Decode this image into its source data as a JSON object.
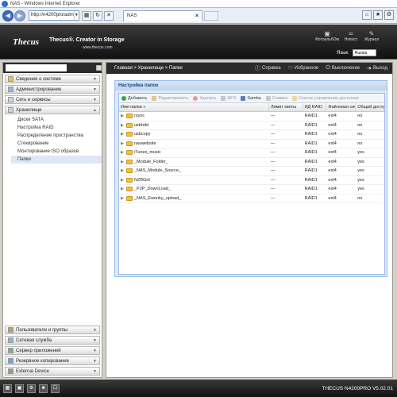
{
  "browser": {
    "title": "NAS - Windows Internet Explorer",
    "address": "http://n4200pro/adm",
    "tab_label": "NAS"
  },
  "header": {
    "brand": "Thecus",
    "tagline": "Thecus®. Creator in Storage",
    "website": "www.thecus.com",
    "icons": [
      {
        "label": "ФотоальбОм",
        "icon": "photo-album-icon"
      },
      {
        "label": "Новост",
        "icon": "rss-icon"
      },
      {
        "label": "Журнал",
        "icon": "log-icon"
      }
    ],
    "language_label": "Язык:",
    "language_value": "Russia"
  },
  "sidebar": {
    "sections_top": [
      {
        "label": "Сведения о системе",
        "icon": "info-icon"
      },
      {
        "label": "Администрирование",
        "icon": "admin-icon"
      },
      {
        "label": "Сеть и сервисы",
        "icon": "network-icon"
      },
      {
        "label": "Хранилище",
        "icon": "storage-icon"
      }
    ],
    "storage_items": [
      {
        "label": "Диски SATA"
      },
      {
        "label": "Настройка RAID"
      },
      {
        "label": "Распределение пространства"
      },
      {
        "label": "Стекирование"
      },
      {
        "label": "Монтирование ISO образов"
      },
      {
        "label": "Папки"
      }
    ],
    "sections_bottom": [
      {
        "label": "Пользователи и группы",
        "icon": "users-icon"
      },
      {
        "label": "Сетевая служба",
        "icon": "network-service-icon"
      },
      {
        "label": "Сервер приложений",
        "icon": "app-server-icon"
      },
      {
        "label": "Резервное копирование",
        "icon": "backup-icon"
      },
      {
        "label": "External Device",
        "icon": "external-device-icon"
      }
    ]
  },
  "breadcrumb": {
    "text": "Главная > Хранилище > Папки",
    "links": [
      {
        "label": "Справка",
        "icon": "help-icon"
      },
      {
        "label": "Избранное",
        "icon": "favorites-icon"
      },
      {
        "label": "Выключение",
        "icon": "power-icon"
      },
      {
        "label": "Выход",
        "icon": "logout-icon"
      }
    ]
  },
  "panel": {
    "title": "Настройка папок",
    "toolbar": [
      {
        "label": "Добавить",
        "icon": "add-icon",
        "enabled": true
      },
      {
        "label": "Редактировать",
        "icon": "edit-icon",
        "enabled": false
      },
      {
        "label": "Удалить",
        "icon": "delete-icon",
        "enabled": false
      },
      {
        "label": "NFS",
        "icon": "nfs-icon",
        "enabled": false
      },
      {
        "label": "Samba",
        "icon": "samba-icon",
        "enabled": true
      },
      {
        "label": "Снимок",
        "icon": "snapshot-icon",
        "enabled": false
      },
      {
        "label": "Список управления доступом",
        "icon": "acl-icon",
        "enabled": false
      }
    ],
    "columns": [
      "Имя папки »",
      "Лимит квоты",
      "ИД RAID",
      "Файловая система",
      "Общий доступ"
    ],
    "rows": [
      {
        "name": "rsync",
        "quota": "—",
        "raid": "RAID1",
        "fs": "ext4",
        "share": "no"
      },
      {
        "name": "usbhdd",
        "quota": "—",
        "raid": "RAID1",
        "fs": "ext4",
        "share": "no"
      },
      {
        "name": "usbcopy",
        "quota": "—",
        "raid": "RAID1",
        "fs": "ext4",
        "share": "no"
      },
      {
        "name": "naswebsite",
        "quota": "—",
        "raid": "RAID1",
        "fs": "ext4",
        "share": "no"
      },
      {
        "name": "iTunes_music",
        "quota": "—",
        "raid": "RAID1",
        "fs": "ext4",
        "share": "yes"
      },
      {
        "name": "_Module_Folder_",
        "quota": "—",
        "raid": "RAID1",
        "fs": "ext4",
        "share": "yes"
      },
      {
        "name": "_NAS_Module_Source_",
        "quota": "—",
        "raid": "RAID1",
        "fs": "ext4",
        "share": "yes"
      },
      {
        "name": "NZBGet",
        "quota": "—",
        "raid": "RAID1",
        "fs": "ext4",
        "share": "yes"
      },
      {
        "name": "_P2P_DownLoad_",
        "quota": "—",
        "raid": "RAID1",
        "fs": "ext4",
        "share": "yes"
      },
      {
        "name": "_NAS_Ewonky_upload_",
        "quota": "—",
        "raid": "RAID1",
        "fs": "ext4",
        "share": "no"
      }
    ]
  },
  "footer": {
    "version": "THECUS N4200PRO V5.02.01",
    "icons": [
      "footer-icon-1",
      "footer-icon-2",
      "footer-icon-3",
      "footer-icon-4",
      "footer-icon-5"
    ]
  },
  "colors": {
    "accent": "#15428b",
    "dark_bar": "#2b2b2b",
    "folder": "#f0c040"
  }
}
